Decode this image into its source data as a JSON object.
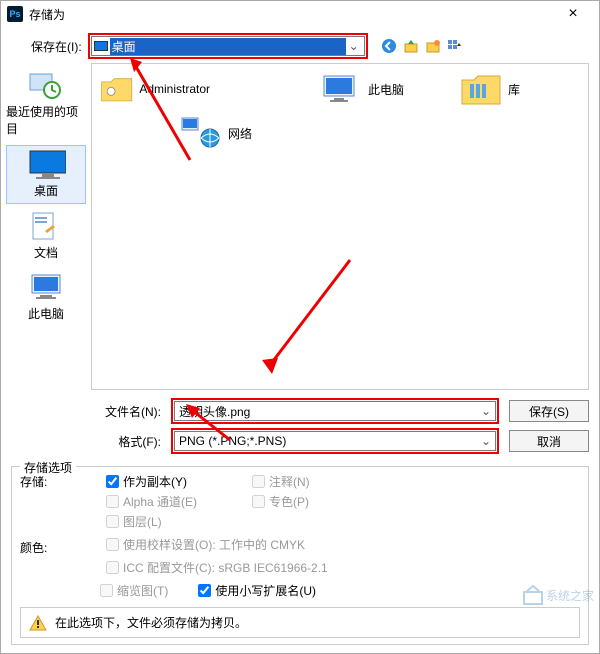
{
  "titlebar": {
    "title": "存储为"
  },
  "row1": {
    "save_in_label": "保存在(I):",
    "save_in_value": "桌面"
  },
  "places": {
    "recent": "最近使用的项目",
    "desktop": "桌面",
    "documents": "文档",
    "thispc": "此电脑"
  },
  "filelist": {
    "admin": "Administrator",
    "libraries": "库",
    "thispc": "此电脑",
    "network": "网络"
  },
  "fields": {
    "filename_label": "文件名(N):",
    "filename_value": "透明头像.png",
    "format_label": "格式(F):",
    "format_value": "PNG (*.PNG;*.PNS)"
  },
  "buttons": {
    "save": "保存(S)",
    "cancel": "取消"
  },
  "options": {
    "title": "存储选项",
    "storage": "存储:",
    "as_copy": "作为副本(Y)",
    "notes": "注释(N)",
    "alpha": "Alpha 通道(E)",
    "spot": "专色(P)",
    "layers": "图层(L)",
    "color": "颜色:",
    "proof": "使用校样设置(O): 工作中的 CMYK",
    "icc": "ICC 配置文件(C): sRGB IEC61966-2.1",
    "thumb": "缩览图(T)",
    "lowercase_ext": "使用小写扩展名(U)",
    "warning": "在此选项下，文件必须存储为拷贝。"
  },
  "watermark": "系统之家"
}
